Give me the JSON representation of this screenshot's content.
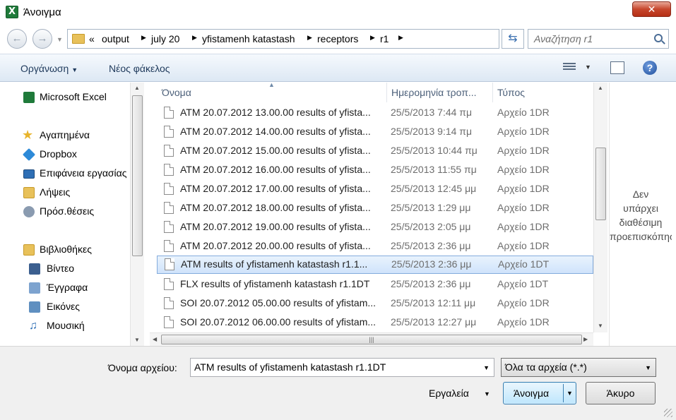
{
  "window": {
    "title": "Άνοιγμα",
    "close_label": "✕"
  },
  "address": {
    "overflow": "«",
    "breadcrumbs": [
      "output",
      "july 20",
      "yfistamenh katastash",
      "receptors",
      "r1"
    ],
    "search_placeholder": "Αναζήτηση r1"
  },
  "toolbar": {
    "organize": "Οργάνωση",
    "new_folder": "Νέος φάκελος",
    "help": "?"
  },
  "nav": {
    "items": [
      {
        "label": "Microsoft Excel",
        "icon": "excel-icon",
        "color": "#1f7a3a"
      },
      {
        "label": "Αγαπημένα",
        "icon": "star-icon",
        "color": "#e8b42b"
      },
      {
        "label": "Dropbox",
        "icon": "dropbox-icon",
        "color": "#2d8ad8"
      },
      {
        "label": "Επιφάνεια εργασίας",
        "icon": "desktop-icon",
        "color": "#2f6fb5"
      },
      {
        "label": "Λήψεις",
        "icon": "downloads-folder-icon",
        "color": "#e8c15a"
      },
      {
        "label": "Πρόσ.θέσεις",
        "icon": "recent-places-icon",
        "color": "#8a9bb0"
      },
      {
        "label": "Βιβλιοθήκες",
        "icon": "libraries-icon",
        "color": "#e8c15a"
      },
      {
        "label": "Βίντεο",
        "icon": "videos-icon",
        "color": "#3b5f8f"
      },
      {
        "label": "Έγγραφα",
        "icon": "documents-icon",
        "color": "#7da3cf"
      },
      {
        "label": "Εικόνες",
        "icon": "pictures-icon",
        "color": "#5f8fc0"
      },
      {
        "label": "Μουσική",
        "icon": "music-icon",
        "color": "#2f6fb5"
      }
    ]
  },
  "files": {
    "headers": {
      "name": "Όνομα",
      "date": "Ημερομηνία τροπ...",
      "type": "Τύπος"
    },
    "rows": [
      {
        "name": "ATM 20.07.2012 13.00.00 results of yfista...",
        "date": "25/5/2013 7:44 πμ",
        "type": "Αρχείο 1DR"
      },
      {
        "name": "ATM 20.07.2012 14.00.00 results of yfista...",
        "date": "25/5/2013 9:14 πμ",
        "type": "Αρχείο 1DR"
      },
      {
        "name": "ATM 20.07.2012 15.00.00 results of yfista...",
        "date": "25/5/2013 10:44 πμ",
        "type": "Αρχείο 1DR"
      },
      {
        "name": "ATM 20.07.2012 16.00.00 results of yfista...",
        "date": "25/5/2013 11:55 πμ",
        "type": "Αρχείο 1DR"
      },
      {
        "name": "ATM 20.07.2012 17.00.00 results of yfista...",
        "date": "25/5/2013 12:45 μμ",
        "type": "Αρχείο 1DR"
      },
      {
        "name": "ATM 20.07.2012 18.00.00 results of yfista...",
        "date": "25/5/2013 1:29 μμ",
        "type": "Αρχείο 1DR"
      },
      {
        "name": "ATM 20.07.2012 19.00.00 results of yfista...",
        "date": "25/5/2013 2:05 μμ",
        "type": "Αρχείο 1DR"
      },
      {
        "name": "ATM 20.07.2012 20.00.00 results of yfista...",
        "date": "25/5/2013 2:36 μμ",
        "type": "Αρχείο 1DR"
      },
      {
        "name": "ATM results of yfistamenh katastash r1.1...",
        "date": "25/5/2013 2:36 μμ",
        "type": "Αρχείο 1DT",
        "selected": true
      },
      {
        "name": "FLX results of yfistamenh katastash r1.1DT",
        "date": "25/5/2013 2:36 μμ",
        "type": "Αρχείο 1DT"
      },
      {
        "name": "SOI 20.07.2012 05.00.00 results of yfistam...",
        "date": "25/5/2013 12:11 μμ",
        "type": "Αρχείο 1DR"
      },
      {
        "name": "SOI 20.07.2012 06.00.00 results of yfistam...",
        "date": "25/5/2013 12:27 μμ",
        "type": "Αρχείο 1DR"
      }
    ]
  },
  "preview": {
    "line1": "Δεν",
    "line2": "υπάρχει",
    "line3": "διαθέσιμη",
    "line4": "προεπισκόπηση"
  },
  "bottom": {
    "filename_label": "Όνομα αρχείου:",
    "filename_value": "ATM results of yfistamenh katastash r1.1DT",
    "filetype_value": "Όλα τα αρχεία (*.*)",
    "tools_label": "Εργαλεία",
    "open_label": "Άνοιγμα",
    "cancel_label": "Άκυρο"
  }
}
